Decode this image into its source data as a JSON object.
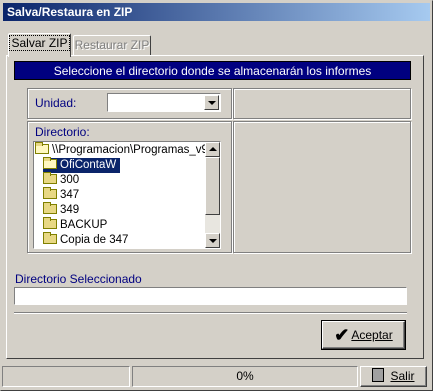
{
  "window": {
    "title": "Salva/Restaura en ZIP"
  },
  "tabs": [
    {
      "label": "Salvar ZIP",
      "active": true
    },
    {
      "label": "Restaurar ZIP",
      "active": false
    }
  ],
  "banner": {
    "text": "Seleccione el directorio donde se almacenarán los informes"
  },
  "unidad": {
    "label": "Unidad:",
    "value": ""
  },
  "directorio": {
    "label": "Directorio:",
    "items": [
      {
        "text": "\\\\Programacion\\Programas_v9",
        "icon": "open-folder-icon",
        "selected": false
      },
      {
        "text": "OfiContaW",
        "icon": "open-folder-icon",
        "selected": true
      },
      {
        "text": "300",
        "icon": "folder-icon",
        "selected": false
      },
      {
        "text": "347",
        "icon": "folder-icon",
        "selected": false
      },
      {
        "text": "349",
        "icon": "folder-icon",
        "selected": false
      },
      {
        "text": "BACKUP",
        "icon": "folder-icon",
        "selected": false
      },
      {
        "text": "Copia de 347",
        "icon": "folder-icon",
        "selected": false
      }
    ]
  },
  "seleccionado": {
    "label": "Directorio Seleccionado",
    "value": ""
  },
  "buttons": {
    "aceptar": "Aceptar",
    "salir": "Salir"
  },
  "status": {
    "progress_text": "0%",
    "progress": 0
  },
  "colors": {
    "title_start": "#0a246a",
    "title_end": "#a6caf0",
    "selection": "#0a246a",
    "banner": "#000080"
  }
}
